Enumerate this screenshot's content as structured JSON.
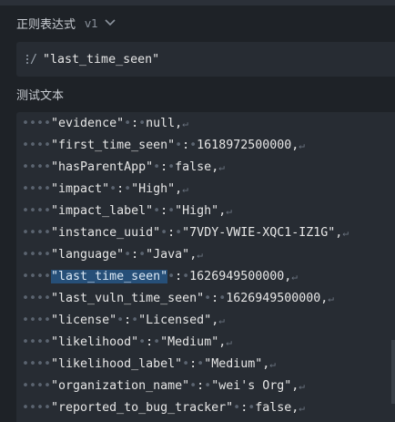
{
  "regex_section": {
    "title": "正则表达式",
    "version": "v1",
    "pattern": "\"last_time_seen\""
  },
  "test_section": {
    "title": "测试文本",
    "lines": [
      {
        "key": "\"evidence\"",
        "sep": ":",
        "value": "null",
        "tail": ","
      },
      {
        "key": "\"first_time_seen\"",
        "sep": ":",
        "value": "1618972500000",
        "tail": ","
      },
      {
        "key": "\"hasParentApp\"",
        "sep": ":",
        "value": "false",
        "tail": ","
      },
      {
        "key": "\"impact\"",
        "sep": ":",
        "value": "\"High\"",
        "tail": ","
      },
      {
        "key": "\"impact_label\"",
        "sep": ":",
        "value": "\"High\"",
        "tail": ","
      },
      {
        "key": "\"instance_uuid\"",
        "sep": ":",
        "value": "\"7VDY-VWIE-XQC1-IZ1G\"",
        "tail": ","
      },
      {
        "key": "\"language\"",
        "sep": ":",
        "value": "\"Java\"",
        "tail": ","
      },
      {
        "key": "\"last_time_seen\"",
        "sep": ":",
        "value": "1626949500000",
        "tail": ",",
        "highlight": true
      },
      {
        "key": "\"last_vuln_time_seen\"",
        "sep": ":",
        "value": "1626949500000",
        "tail": ","
      },
      {
        "key": "\"license\"",
        "sep": ":",
        "value": "\"Licensed\"",
        "tail": ","
      },
      {
        "key": "\"likelihood\"",
        "sep": ":",
        "value": "\"Medium\"",
        "tail": ","
      },
      {
        "key": "\"likelihood_label\"",
        "sep": ":",
        "value": "\"Medium\"",
        "tail": ","
      },
      {
        "key": "\"organization_name\"",
        "sep": ":",
        "value": "\"wei's Org\"",
        "tail": ","
      },
      {
        "key": "\"reported_to_bug_tracker\"",
        "sep": ":",
        "value": "false",
        "tail": ","
      }
    ]
  },
  "colors": {
    "background": "#1e2227",
    "panel": "#272c33",
    "highlight": "#264f78"
  }
}
